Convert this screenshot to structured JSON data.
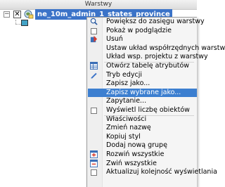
{
  "panel": {
    "title": "Warstwy",
    "layer": {
      "expander": "−",
      "check": "✕",
      "name": "ne_10m_admin_1_states_province"
    }
  },
  "colors": {
    "selection": "#3b73c8",
    "menu_highlight": "#3c7fd0",
    "legend_fill": "#43a3c6"
  },
  "menu": {
    "items": [
      {
        "label": "Powiększ do zasięgu warstwy",
        "icon": "zoom-to-layer-icon"
      },
      {
        "label": "Pokaż w podglądzie",
        "icon": "checkbox-icon"
      },
      {
        "label": "Usuń",
        "icon": "remove-layer-icon"
      },
      {
        "label": "Ustaw układ współrzędnych warstwy",
        "icon": ""
      },
      {
        "label": "Układ wsp. projektu z warstwy",
        "icon": ""
      },
      {
        "label": "Otwórz tabelę atrybutów",
        "icon": "attribute-table-icon"
      },
      {
        "label": "Tryb edycji",
        "icon": "pencil-icon"
      },
      {
        "label": "Zapisz jako...",
        "icon": ""
      },
      {
        "label": "Zapisz wybrane jako...",
        "icon": ""
      },
      {
        "label": "Zapytanie...",
        "icon": ""
      },
      {
        "label": "Wyświetl liczbę obiektów",
        "icon": "checkbox-icon"
      },
      {
        "label": "Właściwości",
        "icon": ""
      },
      {
        "label": "Zmień nazwę",
        "icon": ""
      },
      {
        "label": "Kopiuj styl",
        "icon": ""
      },
      {
        "label": "Dodaj nową grupę",
        "icon": ""
      },
      {
        "label": "Rozwiń wszystkie",
        "icon": "expand-all-icon"
      },
      {
        "label": "Zwiń wszystkie",
        "icon": "collapse-all-icon"
      },
      {
        "label": "Aktualizuj kolejność wyświetlania",
        "icon": "checkbox-icon"
      }
    ]
  }
}
